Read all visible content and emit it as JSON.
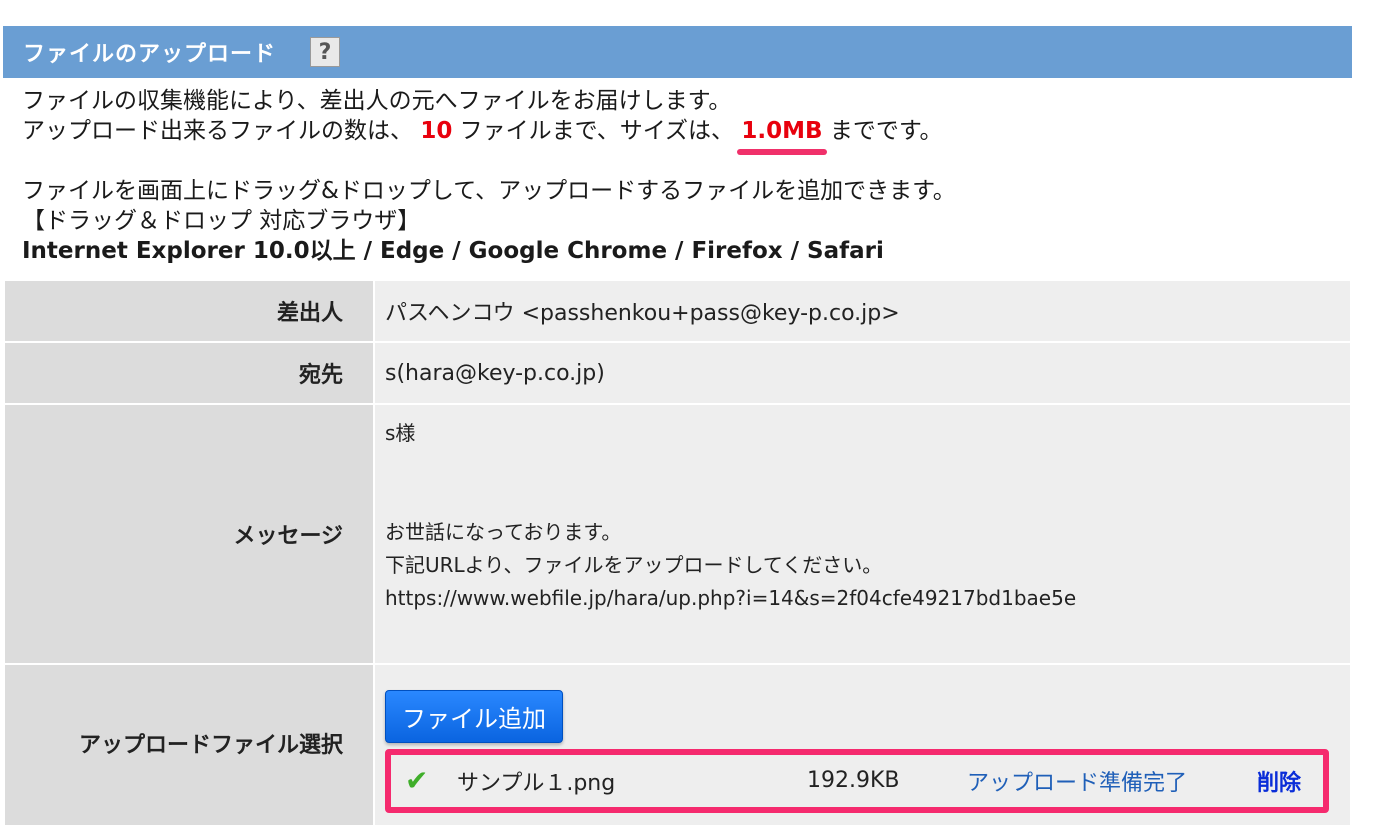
{
  "header": {
    "title": "ファイルのアップロード",
    "help_glyph": "?"
  },
  "intro": {
    "line1": "ファイルの収集機能により、差出人の元へファイルをお届けします。",
    "line2_pre": "アップロード出来るファイルの数は、",
    "file_count": "10",
    "line2_mid": "ファイルまで、サイズは、",
    "size_limit": "1.0MB",
    "line2_post": "までです。",
    "line3": "ファイルを画面上にドラッグ&ドロップして、アップロードするファイルを追加できます。",
    "line4": "【ドラッグ＆ドロップ 対応ブラウザ】",
    "browsers": "Internet Explorer 10.0以上 / Edge / Google Chrome / Firefox / Safari"
  },
  "form": {
    "sender_label": "差出人",
    "sender_value": "パスヘンコウ <passhenkou+pass@key-p.co.jp>",
    "to_label": "宛先",
    "to_value": "s(hara@key-p.co.jp)",
    "message_label": "メッセージ",
    "message_value": "s様\n\n\nお世話になっております。\n下記URLより、ファイルをアップロードしてください。\nhttps://www.webfile.jp/hara/up.php?i=14&s=2f04cfe49217bd1bae5e",
    "upload_label": "アップロードファイル選択",
    "add_button": "ファイル追加"
  },
  "files": [
    {
      "icon": "check-icon",
      "check_glyph": "✔",
      "name": "サンプル１.png",
      "size": "192.9KB",
      "status": "アップロード準備完了",
      "delete_label": "削除"
    }
  ],
  "colors": {
    "header_bg": "#6a9ed3",
    "highlight": "#e8000d",
    "annotation": "#f52a6e",
    "button": "#0a64e0",
    "status": "#1f5fb8"
  }
}
